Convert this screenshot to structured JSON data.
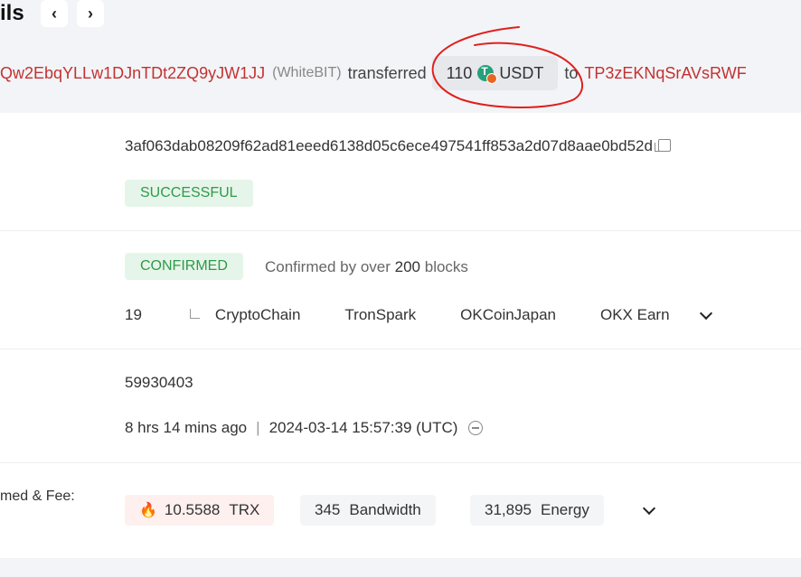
{
  "header": {
    "title_fragment": "ils",
    "prev_icon": "chevron-left-icon",
    "next_icon": "chevron-right-icon"
  },
  "summary": {
    "from_address": "Qw2EbqYLLw1DJnTDt2ZQ9yJW1JJ",
    "from_entity": "(WhiteBIT)",
    "verb": "transferred",
    "amount": "110",
    "token": "USDT",
    "to_word": "to",
    "to_address": "TP3zEKNqSrAVsRWF"
  },
  "details": {
    "hash": "3af063dab08209f62ad81eeed6138d05c6ece497541ff853a2d07d8aae0bd52d",
    "status": "SUCCESSFUL",
    "confirmation_badge": "CONFIRMED",
    "confirm_prefix": "Confirmed by over",
    "confirm_count": "200",
    "confirm_suffix": "blocks",
    "sr_count": "19",
    "sr_names": [
      "CryptoChain",
      "TronSpark",
      "OKCoinJapan",
      "OKX Earn"
    ],
    "block": "59930403",
    "age": "8 hrs 14 mins ago",
    "timestamp": "2024-03-14 15:57:39 (UTC)",
    "fee_label": "med & Fee:",
    "trx_amount": "10.5588",
    "trx_unit": "TRX",
    "bandwidth_amount": "345",
    "bandwidth_unit": "Bandwidth",
    "energy_amount": "31,895",
    "energy_unit": "Energy"
  },
  "colors": {
    "address": "#c23232",
    "success": "#2e9a4a",
    "annotation": "#e0201c"
  }
}
